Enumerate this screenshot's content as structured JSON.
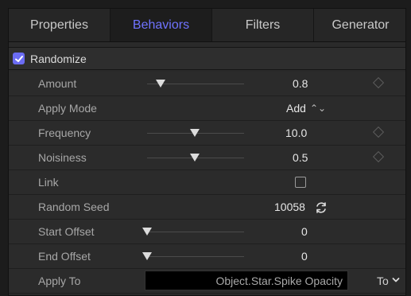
{
  "tabs": [
    {
      "label": "Properties",
      "active": false
    },
    {
      "label": "Behaviors",
      "active": true
    },
    {
      "label": "Filters",
      "active": false
    },
    {
      "label": "Generator",
      "active": false
    }
  ],
  "section": {
    "title": "Randomize",
    "enabled": true
  },
  "rows": {
    "amount": {
      "label": "Amount",
      "value": "0.8",
      "slider_position": 0.14
    },
    "apply_mode": {
      "label": "Apply Mode",
      "value": "Add"
    },
    "frequency": {
      "label": "Frequency",
      "value": "10.0",
      "slider_position": 0.49
    },
    "noisiness": {
      "label": "Noisiness",
      "value": "0.5",
      "slider_position": 0.49
    },
    "link": {
      "label": "Link",
      "checked": false
    },
    "random_seed": {
      "label": "Random Seed",
      "value": "10058"
    },
    "start_offset": {
      "label": "Start Offset",
      "value": "0",
      "slider_position": 0.0
    },
    "end_offset": {
      "label": "End Offset",
      "value": "0",
      "slider_position": 0.0
    },
    "apply_to": {
      "label": "Apply To",
      "value": "Object.Star.Spike Opacity",
      "button_label": "To"
    }
  },
  "colors": {
    "accent": "#6f73ff",
    "checkbox": "#6b6cf3",
    "background": "#2b2b2b"
  }
}
